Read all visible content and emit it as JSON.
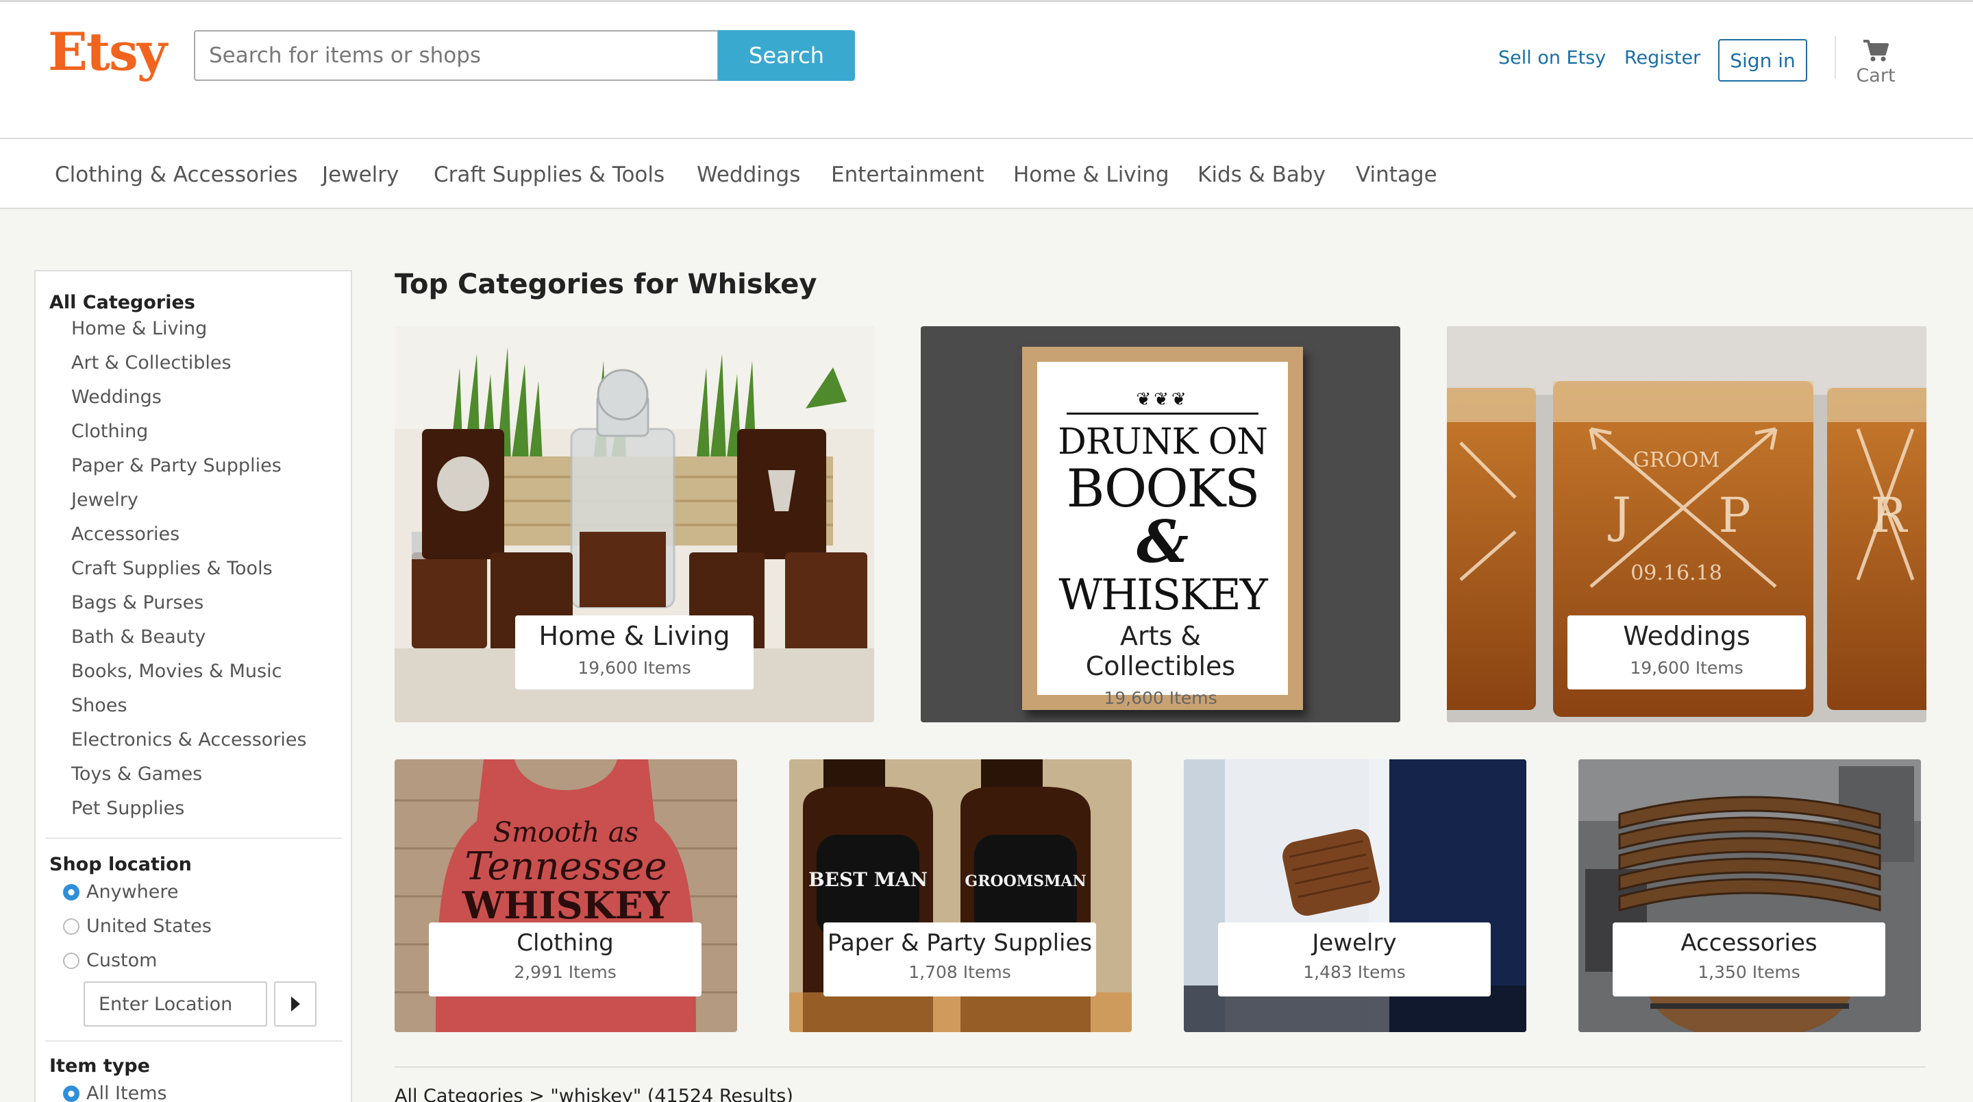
{
  "header": {
    "logo": "Etsy",
    "search_placeholder": "Search for items or shops",
    "search_button": "Search",
    "sell_link": "Sell on Etsy",
    "register_link": "Register",
    "signin_button": "Sign in",
    "cart_label": "Cart",
    "cart_icon": "cart-icon"
  },
  "nav": {
    "items": [
      "Clothing & Accessories",
      "Jewelry",
      "Craft Supplies & Tools",
      "Weddings",
      "Entertainment",
      "Home & Living",
      "Kids & Baby",
      "Vintage"
    ]
  },
  "sidebar": {
    "categories_title": "All Categories",
    "categories": [
      "Home & Living",
      "Art & Collectibles",
      "Weddings",
      "Clothing",
      "Paper & Party Supplies",
      "Jewelry",
      "Accessories",
      "Craft Supplies & Tools",
      "Bags & Purses",
      "Bath & Beauty",
      "Books, Movies & Music",
      "Shoes",
      "Electronics & Accessories",
      "Toys & Games",
      "Pet Supplies"
    ],
    "shop_location_title": "Shop location",
    "location_options": [
      "Anywhere",
      "United States",
      "Custom"
    ],
    "location_selected": "Anywhere",
    "location_placeholder": "Enter Location",
    "item_type_title": "Item type",
    "item_type_options": [
      "All Items"
    ],
    "item_type_selected": "All Items"
  },
  "main": {
    "title": "Top Categories for Whiskey",
    "top_tiles": [
      {
        "title": "Home & Living",
        "count": "19,600 Items",
        "image": "decanter-glasses-photo"
      },
      {
        "title": "Arts & Collectibles",
        "count": "19,600 Items",
        "image": "framed-print-photo",
        "print_lines": [
          "DRUNK ON",
          "BOOKS",
          "&",
          "WHISKEY"
        ]
      },
      {
        "title": "Weddings",
        "count": "19,600 Items",
        "image": "engraved-glasses-photo",
        "engraving": [
          "GROOM",
          "J",
          "P",
          "09.16.18",
          "R"
        ]
      }
    ],
    "bottom_tiles": [
      {
        "title": "Clothing",
        "count": "2,991 Items",
        "image": "tank-top-photo",
        "print_lines": [
          "Smooth as",
          "Tennessee",
          "WHISKEY"
        ]
      },
      {
        "title": "Paper & Party Supplies",
        "count": "1,708 Items",
        "image": "bottle-labels-photo",
        "labels": [
          "BEST MAN",
          "GROOMSMAN"
        ]
      },
      {
        "title": "Jewelry",
        "count": "1,483 Items",
        "image": "cufflinks-photo"
      },
      {
        "title": "Accessories",
        "count": "1,350 Items",
        "image": "barrel-staves-photo"
      }
    ],
    "breadcrumb": "All Categories > \"whiskey\" (41524 Results)"
  },
  "colors": {
    "brand": "#f1641e",
    "search_button": "#3aa9d0",
    "link": "#1a6ea3",
    "radio_selected": "#2f8fd8"
  }
}
